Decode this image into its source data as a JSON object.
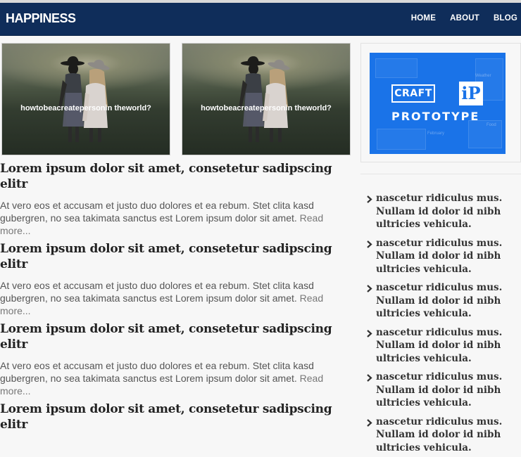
{
  "header": {
    "brand": "HAPPINESS",
    "nav": [
      {
        "label": "HOME"
      },
      {
        "label": "ABOUT"
      },
      {
        "label": "BLOG"
      }
    ]
  },
  "featured": [
    {
      "caption": "howtobeacreatepersonin theworld?"
    },
    {
      "caption": "howtobeacreatepersonin theworld?"
    }
  ],
  "posts": [
    {
      "title": "Lorem ipsum dolor sit amet, consetetur sadipscing elitr",
      "excerpt": "At vero eos et accusam et justo duo dolores et ea rebum. Stet clita kasd gubergren, no sea takimata sanctus est Lorem ipsum dolor sit amet. ",
      "read_more": "Read more..."
    },
    {
      "title": "Lorem ipsum dolor sit amet, consetetur sadipscing elitr",
      "excerpt": "At vero eos et accusam et justo duo dolores et ea rebum. Stet clita kasd gubergren, no sea takimata sanctus est Lorem ipsum dolor sit amet. ",
      "read_more": "Read more..."
    },
    {
      "title": "Lorem ipsum dolor sit amet, consetetur sadipscing elitr",
      "excerpt": "At vero eos et accusam et justo duo dolores et ea rebum. Stet clita kasd gubergren, no sea takimata sanctus est Lorem ipsum dolor sit amet. ",
      "read_more": "Read more..."
    },
    {
      "title": "Lorem ipsum dolor sit amet, consetetur sadipscing elitr"
    }
  ],
  "sidebar": {
    "ad": {
      "brand_box": "CRAFT",
      "logo_letter": "iP",
      "product": "PROTOTYPE",
      "small_text": [
        "February",
        "Food",
        "Weather"
      ]
    },
    "links": [
      {
        "icon": "chevron-right-icon",
        "label": "nascetur ridiculus mus. Nullam id dolor id nibh ultricies vehicula."
      },
      {
        "icon": "chevron-right-icon",
        "label": "nascetur ridiculus mus. Nullam id dolor id nibh ultricies vehicula."
      },
      {
        "icon": "chevron-right-icon",
        "label": "nascetur ridiculus mus. Nullam id dolor id nibh ultricies vehicula."
      },
      {
        "icon": "chevron-right-icon",
        "label": "nascetur ridiculus mus. Nullam id dolor id nibh ultricies vehicula."
      },
      {
        "icon": "chevron-right-icon",
        "label": "nascetur ridiculus mus. Nullam id dolor id nibh ultricies vehicula."
      },
      {
        "icon": "chevron-right-icon",
        "label": "nascetur ridiculus mus. Nullam id dolor id nibh ultricies vehicula."
      }
    ]
  },
  "colors": {
    "navbar": "#0f2d5a",
    "background": "#f7f7f7",
    "ad_blue": "#1a73e8",
    "title_text": "#222222",
    "body_text": "#555555"
  }
}
